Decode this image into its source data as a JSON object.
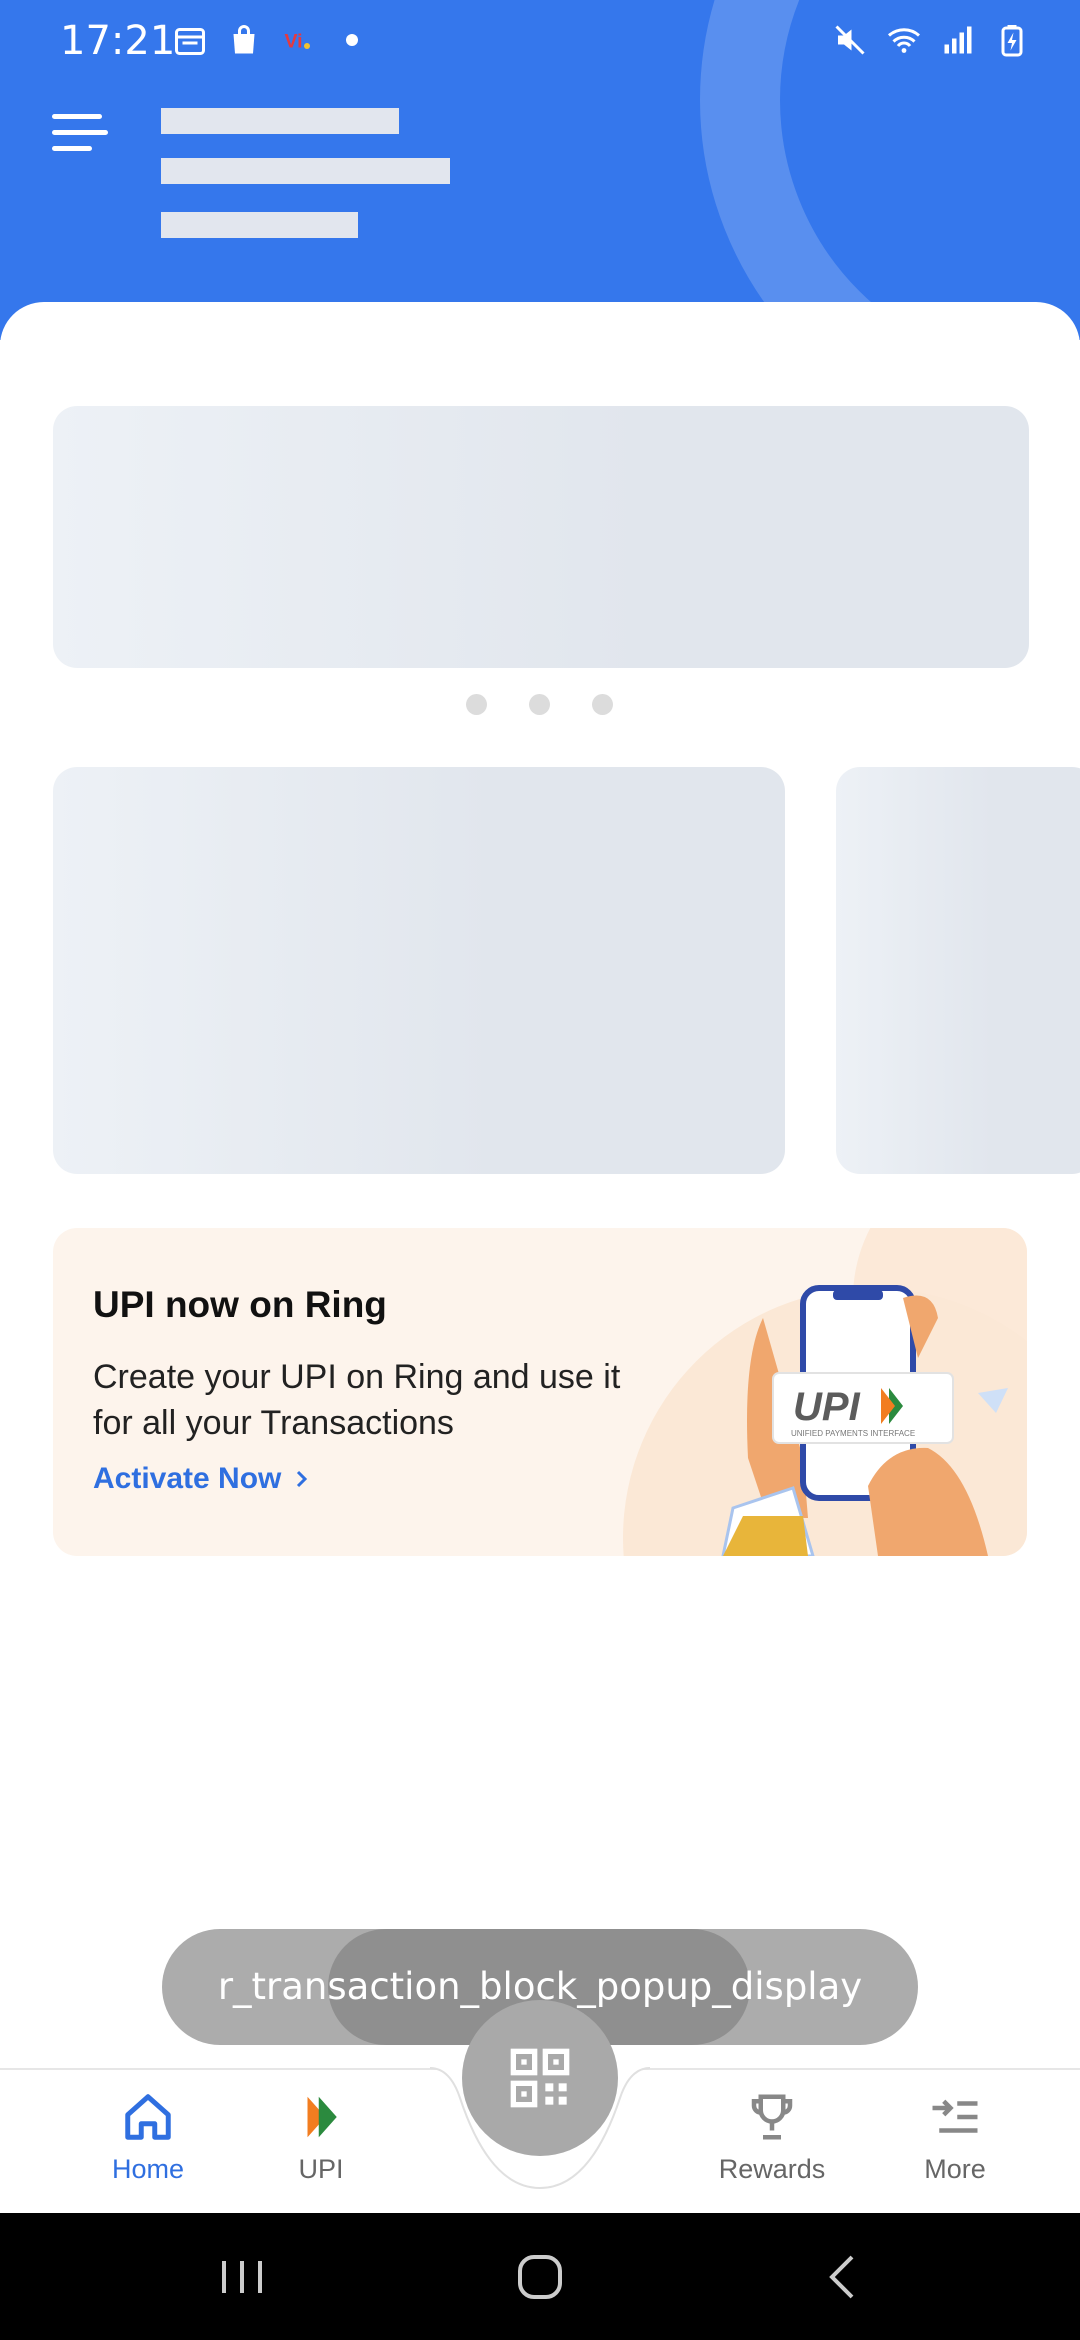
{
  "status_bar": {
    "time": "17:21",
    "icons_left": [
      "calendar-icon",
      "shopping-bag-icon",
      "vi-icon",
      "dot-icon"
    ],
    "icons_right": [
      "mute-icon",
      "wifi-icon",
      "signal-icon",
      "battery-charging-icon"
    ]
  },
  "header": {
    "menu_icon": "hamburger-icon"
  },
  "promo": {
    "title": "UPI now on Ring",
    "body": "Create your UPI on Ring and use it for all your Transactions",
    "link_label": "Activate Now",
    "illustration_text": "UPI",
    "illustration_subtext": "UNIFIED PAYMENTS INTERFACE"
  },
  "carousel": {
    "page_count": 3
  },
  "toast": {
    "text": "r_transaction_block_popup_display"
  },
  "bottom_nav": {
    "items": [
      {
        "label": "Home",
        "icon": "home-icon",
        "active": true
      },
      {
        "label": "UPI",
        "icon": "upi-icon",
        "active": false
      },
      {
        "label": "Rewards",
        "icon": "trophy-icon",
        "active": false
      },
      {
        "label": "More",
        "icon": "more-icon",
        "active": false
      }
    ],
    "center_button_icon": "qr-scan-icon"
  },
  "colors": {
    "header_bg": "#3577ec",
    "accent": "#2f6fe0",
    "promo_bg": "#fdf4ec"
  }
}
